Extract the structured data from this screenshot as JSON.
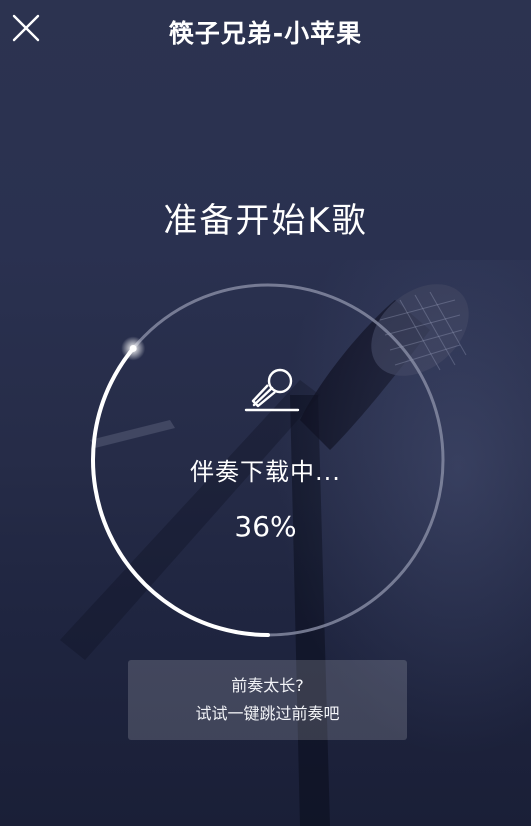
{
  "header": {
    "title": "筷子兄弟-小苹果",
    "close_icon": "close-icon"
  },
  "main": {
    "headline": "准备开始K歌",
    "status_text": "伴奏下载中...",
    "progress_text": "36%",
    "progress_fraction": 0.36,
    "mic_icon": "microphone-icon"
  },
  "skip_prelude": {
    "line1": "前奏太长?",
    "line2": "试试一键跳过前奏吧"
  },
  "colors": {
    "background": "#272d49",
    "ring_track": "#8a8fa6",
    "ring_progress": "#ffffff"
  }
}
